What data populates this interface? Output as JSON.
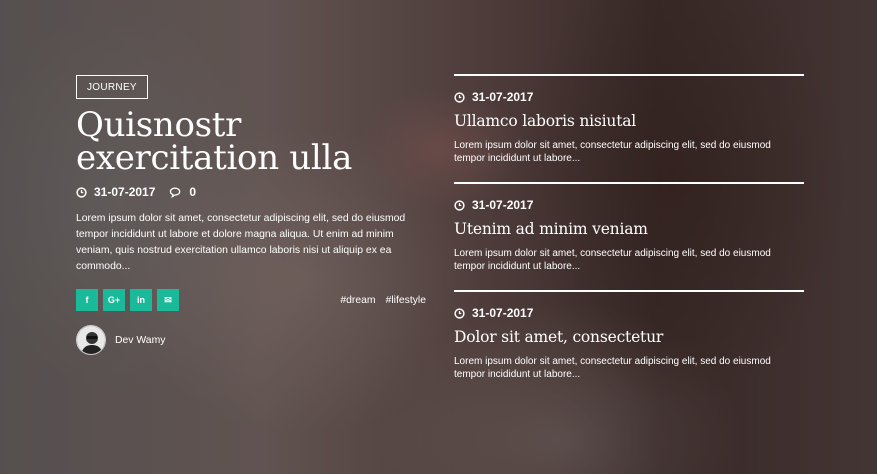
{
  "featured": {
    "category": "JOURNEY",
    "title": "Quisnostr exercitation ulla",
    "date": "31-07-2017",
    "comments": "0",
    "excerpt": "Lorem ipsum dolor sit amet, consectetur adipiscing elit, sed do eiusmod tempor incididunt ut labore et dolore magna aliqua. Ut enim ad minim veniam, quis nostrud exercitation ullamco laboris nisi ut aliquip ex ea commodo...",
    "share": [
      {
        "icon": "facebook-icon",
        "glyph": "f"
      },
      {
        "icon": "google-plus-icon",
        "glyph": "G+"
      },
      {
        "icon": "linkedin-icon",
        "glyph": "in"
      },
      {
        "icon": "email-icon",
        "glyph": "✉"
      }
    ],
    "tags": [
      "#dream",
      "#lifestyle"
    ],
    "author": "Dev Wamy"
  },
  "posts": [
    {
      "date": "31-07-2017",
      "title": "Ullamco laboris nisiutal",
      "excerpt": "Lorem ipsum dolor sit amet, consectetur adipiscing elit, sed do eiusmod tempor incididunt ut labore..."
    },
    {
      "date": "31-07-2017",
      "title": "Utenim ad minim veniam",
      "excerpt": "Lorem ipsum dolor sit amet, consectetur adipiscing elit, sed do eiusmod tempor incididunt ut labore..."
    },
    {
      "date": "31-07-2017",
      "title": "Dolor sit amet, consectetur",
      "excerpt": "Lorem ipsum dolor sit amet, consectetur adipiscing elit, sed do eiusmod tempor incididunt ut labore..."
    }
  ],
  "colors": {
    "accent": "#1ab99a",
    "text": "#ffffff"
  }
}
